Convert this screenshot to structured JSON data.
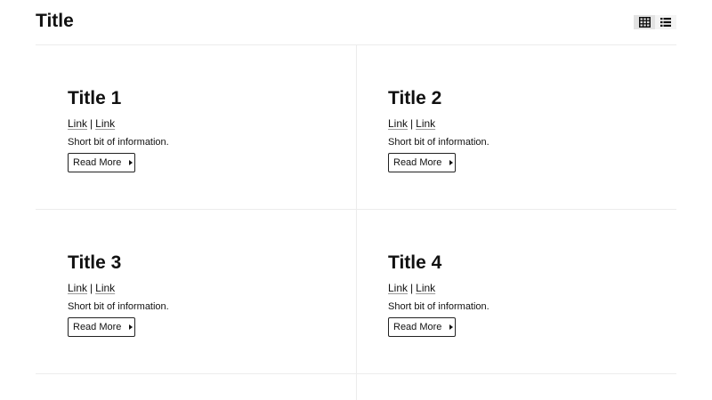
{
  "header": {
    "title": "Title",
    "view_toggle": {
      "options": [
        {
          "name": "grid-view",
          "icon": "grid-icon",
          "active": true
        },
        {
          "name": "list-view",
          "icon": "list-icon",
          "active": false
        }
      ]
    }
  },
  "cards": [
    {
      "title": "Title 1",
      "link1": "Link",
      "separator": "|",
      "link2": "Link",
      "description": "Short bit of information.",
      "button_label": "Read More",
      "button_icon": "caret-right-icon"
    },
    {
      "title": "Title 2",
      "link1": "Link",
      "separator": "|",
      "link2": "Link",
      "description": "Short bit of information.",
      "button_label": "Read More",
      "button_icon": "caret-right-icon"
    },
    {
      "title": "Title 3",
      "link1": "Link",
      "separator": "|",
      "link2": "Link",
      "description": "Short bit of information.",
      "button_label": "Read More",
      "button_icon": "caret-right-icon"
    },
    {
      "title": "Title 4",
      "link1": "Link",
      "separator": "|",
      "link2": "Link",
      "description": "Short bit of information.",
      "button_label": "Read More",
      "button_icon": "caret-right-icon"
    }
  ]
}
